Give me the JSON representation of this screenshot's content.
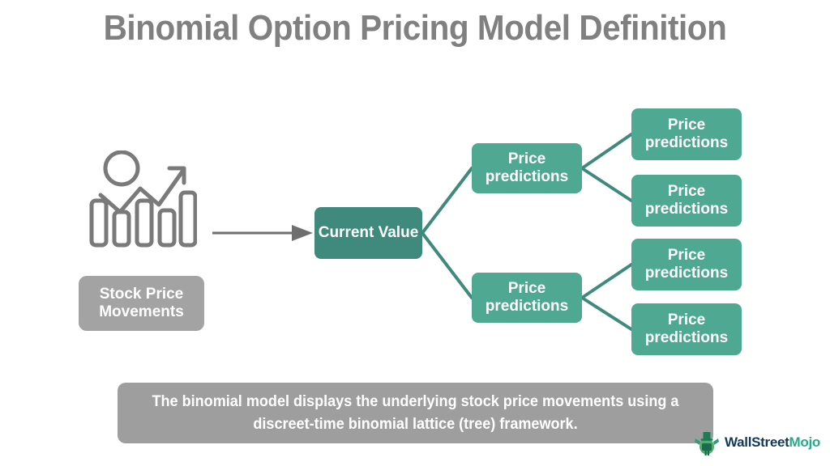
{
  "page": {
    "title": "Binomial Option Pricing Model Definition",
    "background_color": "#ffffff",
    "title_color": "#808080"
  },
  "colors": {
    "root_teal": "#3f8a7d",
    "node_teal": "#4fa891",
    "gray_box": "#a3a3a3",
    "caption_gray": "#9e9e9e",
    "icon_gray": "#7a7a7a",
    "arrow_gray": "#6e6e6e",
    "connector_teal": "#3f8a7d"
  },
  "diagram": {
    "type": "binomial-tree",
    "source": {
      "icon_name": "stock-price-chart-icon",
      "label": "Stock Price Movements"
    },
    "arrow": {
      "icon_name": "right-arrow-icon",
      "direction": "right"
    },
    "root": {
      "label_line1": "Current",
      "label_line2": "Value",
      "label": "Current Value"
    },
    "level1": [
      {
        "label_line1": "Price",
        "label_line2": "predictions",
        "label": "Price predictions"
      },
      {
        "label_line1": "Price",
        "label_line2": "predictions",
        "label": "Price predictions"
      }
    ],
    "level2": [
      {
        "label_line1": "Price",
        "label_line2": "predictions",
        "label": "Price predictions"
      },
      {
        "label_line1": "Price",
        "label_line2": "predictions",
        "label": "Price predictions"
      },
      {
        "label_line1": "Price",
        "label_line2": "predictions",
        "label": "Price predictions"
      },
      {
        "label_line1": "Price",
        "label_line2": "predictions",
        "label": "Price predictions"
      }
    ]
  },
  "caption": {
    "line1": "The binomial model displays the underlying stock price movements",
    "line2": "using a discreet-time binomial lattice (tree) framework.",
    "text": "The binomial model displays the underlying stock price movements using a discreet-time binomial lattice (tree) framework."
  },
  "logo": {
    "icon_name": "wallstreetmojo-mascot-icon",
    "text_part1": "WallStreet",
    "text_part2": "Mojo",
    "full_text": "WallStreetMojo"
  }
}
